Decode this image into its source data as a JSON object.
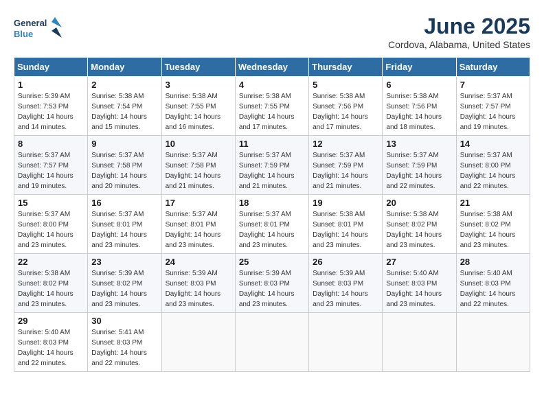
{
  "header": {
    "logo_line1": "General",
    "logo_line2": "Blue",
    "month": "June 2025",
    "location": "Cordova, Alabama, United States"
  },
  "weekdays": [
    "Sunday",
    "Monday",
    "Tuesday",
    "Wednesday",
    "Thursday",
    "Friday",
    "Saturday"
  ],
  "weeks": [
    [
      {
        "day": "1",
        "sunrise": "5:39 AM",
        "sunset": "7:53 PM",
        "daylight": "14 hours and 14 minutes."
      },
      {
        "day": "2",
        "sunrise": "5:38 AM",
        "sunset": "7:54 PM",
        "daylight": "14 hours and 15 minutes."
      },
      {
        "day": "3",
        "sunrise": "5:38 AM",
        "sunset": "7:55 PM",
        "daylight": "14 hours and 16 minutes."
      },
      {
        "day": "4",
        "sunrise": "5:38 AM",
        "sunset": "7:55 PM",
        "daylight": "14 hours and 17 minutes."
      },
      {
        "day": "5",
        "sunrise": "5:38 AM",
        "sunset": "7:56 PM",
        "daylight": "14 hours and 17 minutes."
      },
      {
        "day": "6",
        "sunrise": "5:38 AM",
        "sunset": "7:56 PM",
        "daylight": "14 hours and 18 minutes."
      },
      {
        "day": "7",
        "sunrise": "5:37 AM",
        "sunset": "7:57 PM",
        "daylight": "14 hours and 19 minutes."
      }
    ],
    [
      {
        "day": "8",
        "sunrise": "5:37 AM",
        "sunset": "7:57 PM",
        "daylight": "14 hours and 19 minutes."
      },
      {
        "day": "9",
        "sunrise": "5:37 AM",
        "sunset": "7:58 PM",
        "daylight": "14 hours and 20 minutes."
      },
      {
        "day": "10",
        "sunrise": "5:37 AM",
        "sunset": "7:58 PM",
        "daylight": "14 hours and 21 minutes."
      },
      {
        "day": "11",
        "sunrise": "5:37 AM",
        "sunset": "7:59 PM",
        "daylight": "14 hours and 21 minutes."
      },
      {
        "day": "12",
        "sunrise": "5:37 AM",
        "sunset": "7:59 PM",
        "daylight": "14 hours and 21 minutes."
      },
      {
        "day": "13",
        "sunrise": "5:37 AM",
        "sunset": "7:59 PM",
        "daylight": "14 hours and 22 minutes."
      },
      {
        "day": "14",
        "sunrise": "5:37 AM",
        "sunset": "8:00 PM",
        "daylight": "14 hours and 22 minutes."
      }
    ],
    [
      {
        "day": "15",
        "sunrise": "5:37 AM",
        "sunset": "8:00 PM",
        "daylight": "14 hours and 23 minutes."
      },
      {
        "day": "16",
        "sunrise": "5:37 AM",
        "sunset": "8:01 PM",
        "daylight": "14 hours and 23 minutes."
      },
      {
        "day": "17",
        "sunrise": "5:37 AM",
        "sunset": "8:01 PM",
        "daylight": "14 hours and 23 minutes."
      },
      {
        "day": "18",
        "sunrise": "5:37 AM",
        "sunset": "8:01 PM",
        "daylight": "14 hours and 23 minutes."
      },
      {
        "day": "19",
        "sunrise": "5:38 AM",
        "sunset": "8:01 PM",
        "daylight": "14 hours and 23 minutes."
      },
      {
        "day": "20",
        "sunrise": "5:38 AM",
        "sunset": "8:02 PM",
        "daylight": "14 hours and 23 minutes."
      },
      {
        "day": "21",
        "sunrise": "5:38 AM",
        "sunset": "8:02 PM",
        "daylight": "14 hours and 23 minutes."
      }
    ],
    [
      {
        "day": "22",
        "sunrise": "5:38 AM",
        "sunset": "8:02 PM",
        "daylight": "14 hours and 23 minutes."
      },
      {
        "day": "23",
        "sunrise": "5:39 AM",
        "sunset": "8:02 PM",
        "daylight": "14 hours and 23 minutes."
      },
      {
        "day": "24",
        "sunrise": "5:39 AM",
        "sunset": "8:03 PM",
        "daylight": "14 hours and 23 minutes."
      },
      {
        "day": "25",
        "sunrise": "5:39 AM",
        "sunset": "8:03 PM",
        "daylight": "14 hours and 23 minutes."
      },
      {
        "day": "26",
        "sunrise": "5:39 AM",
        "sunset": "8:03 PM",
        "daylight": "14 hours and 23 minutes."
      },
      {
        "day": "27",
        "sunrise": "5:40 AM",
        "sunset": "8:03 PM",
        "daylight": "14 hours and 23 minutes."
      },
      {
        "day": "28",
        "sunrise": "5:40 AM",
        "sunset": "8:03 PM",
        "daylight": "14 hours and 22 minutes."
      }
    ],
    [
      {
        "day": "29",
        "sunrise": "5:40 AM",
        "sunset": "8:03 PM",
        "daylight": "14 hours and 22 minutes."
      },
      {
        "day": "30",
        "sunrise": "5:41 AM",
        "sunset": "8:03 PM",
        "daylight": "14 hours and 22 minutes."
      },
      null,
      null,
      null,
      null,
      null
    ]
  ],
  "labels": {
    "sunrise": "Sunrise:",
    "sunset": "Sunset:",
    "daylight": "Daylight:"
  }
}
